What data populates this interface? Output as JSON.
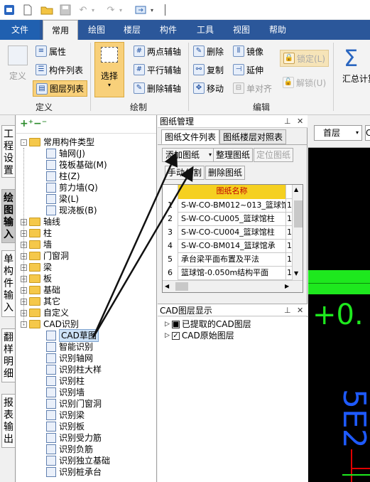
{
  "ribbon_tabs": [
    "文件",
    "常用",
    "绘图",
    "楼层",
    "构件",
    "工具",
    "视图",
    "帮助"
  ],
  "active_tab": "常用",
  "groups": {
    "define": {
      "label": "定义",
      "define_btn": "定义",
      "attr": "属性",
      "component_list": "构件列表",
      "layer_list": "图层列表"
    },
    "draw": {
      "label": "绘制",
      "select": "选择",
      "two_point_aux": "两点辅轴",
      "parallel_aux": "平行辅轴",
      "delete_aux": "删除辅轴"
    },
    "edit": {
      "label": "编辑",
      "delete": "删除",
      "copy": "复制",
      "move": "移动",
      "mirror": "镜像",
      "extend": "延伸",
      "single_align": "单对齐",
      "lock": "锁定(L)",
      "unlock": "解锁(U)"
    },
    "summary": {
      "label": "汇总计算"
    }
  },
  "side_tabs": [
    "工程设置",
    "绘图输入",
    "单构件输入",
    "翻样明细",
    "报表输出"
  ],
  "tree": [
    {
      "label": "常用构件类型",
      "level": 0,
      "kind": "folder",
      "expand": "-"
    },
    {
      "label": "轴网(J)",
      "level": 1,
      "kind": "icon",
      "icon": "axis-grid-icon"
    },
    {
      "label": "筏板基础(M)",
      "level": 1,
      "kind": "icon",
      "icon": "raft-foundation-icon"
    },
    {
      "label": "柱(Z)",
      "level": 1,
      "kind": "icon",
      "icon": "column-icon"
    },
    {
      "label": "剪力墙(Q)",
      "level": 1,
      "kind": "icon",
      "icon": "shear-wall-icon"
    },
    {
      "label": "梁(L)",
      "level": 1,
      "kind": "icon",
      "icon": "beam-icon"
    },
    {
      "label": "现浇板(B)",
      "level": 1,
      "kind": "icon",
      "icon": "slab-icon"
    },
    {
      "label": "轴线",
      "level": 0,
      "kind": "folder",
      "expand": "+"
    },
    {
      "label": "柱",
      "level": 0,
      "kind": "folder",
      "expand": "+"
    },
    {
      "label": "墙",
      "level": 0,
      "kind": "folder",
      "expand": "+"
    },
    {
      "label": "门窗洞",
      "level": 0,
      "kind": "folder",
      "expand": "+"
    },
    {
      "label": "梁",
      "level": 0,
      "kind": "folder",
      "expand": "+"
    },
    {
      "label": "板",
      "level": 0,
      "kind": "folder",
      "expand": "+"
    },
    {
      "label": "基础",
      "level": 0,
      "kind": "folder",
      "expand": "+"
    },
    {
      "label": "其它",
      "level": 0,
      "kind": "folder",
      "expand": "+"
    },
    {
      "label": "自定义",
      "level": 0,
      "kind": "folder",
      "expand": "+"
    },
    {
      "label": "CAD识别",
      "level": 0,
      "kind": "folder",
      "expand": "-"
    },
    {
      "label": "CAD草图",
      "level": 1,
      "kind": "icon",
      "icon": "cad-sketch-icon",
      "selected": true
    },
    {
      "label": "智能识别",
      "level": 1,
      "kind": "icon",
      "icon": "smart-recognize-icon"
    },
    {
      "label": "识别轴网",
      "level": 1,
      "kind": "icon",
      "icon": "recognize-axis-icon"
    },
    {
      "label": "识别柱大样",
      "level": 1,
      "kind": "icon",
      "icon": "recognize-column-detail-icon"
    },
    {
      "label": "识别柱",
      "level": 1,
      "kind": "icon",
      "icon": "recognize-column-icon"
    },
    {
      "label": "识别墙",
      "level": 1,
      "kind": "icon",
      "icon": "recognize-wall-icon"
    },
    {
      "label": "识别门窗洞",
      "level": 1,
      "kind": "icon",
      "icon": "recognize-opening-icon"
    },
    {
      "label": "识别梁",
      "level": 1,
      "kind": "icon",
      "icon": "recognize-beam-icon"
    },
    {
      "label": "识别板",
      "level": 1,
      "kind": "icon",
      "icon": "recognize-slab-icon"
    },
    {
      "label": "识别受力筋",
      "level": 1,
      "kind": "icon",
      "icon": "recognize-main-rebar-icon"
    },
    {
      "label": "识别负筋",
      "level": 1,
      "kind": "icon",
      "icon": "recognize-negative-rebar-icon"
    },
    {
      "label": "识别独立基础",
      "level": 1,
      "kind": "icon",
      "icon": "recognize-isolated-footing-icon"
    },
    {
      "label": "识别桩承台",
      "level": 1,
      "kind": "icon",
      "icon": "recognize-pile-cap-icon"
    }
  ],
  "drawing_manager": {
    "title": "图纸管理",
    "tabs": [
      "图纸文件列表",
      "图纸楼层对照表"
    ],
    "active_tab": "图纸文件列表",
    "buttons": {
      "add": "添加图纸",
      "organize": "整理图纸",
      "locate": "定位图纸",
      "manual_split": "手动分割",
      "delete": "删除图纸"
    },
    "column_header": "图纸名称",
    "rows": [
      {
        "num": "1",
        "name": "S-W-CO-BM012~013_篮球馆",
        "ext": "1"
      },
      {
        "num": "2",
        "name": "S-W-CO-CU005_篮球馆柱",
        "ext": "1"
      },
      {
        "num": "3",
        "name": "S-W-CO-CU004_篮球馆柱",
        "ext": "1"
      },
      {
        "num": "4",
        "name": "S-W-CO-BM014_篮球馆承",
        "ext": "1"
      },
      {
        "num": "5",
        "name": "承台梁平面布置及平法",
        "ext": "1"
      },
      {
        "num": "6",
        "name": "篮球馆-0.050m结构平面",
        "ext": "1"
      }
    ]
  },
  "cad_layers": {
    "title": "CAD图层显示",
    "items": [
      {
        "label": "已提取的CAD图层",
        "checked": "■"
      },
      {
        "label": "CAD原始图层",
        "checked": "✓"
      }
    ]
  },
  "canvas": {
    "floor_select": "首层",
    "floor_extra": "C",
    "text_plus": "+0.",
    "text_vertical": "5E2"
  },
  "colors": {
    "menubar": "#2b579a",
    "canvas_bg": "#000000",
    "canvas_green": "#1ee81e",
    "canvas_blue": "#1e5aff",
    "grid_header": "#f5d020",
    "grid_header_text": "#c00000",
    "selected_btn_bg": "#f8d07a"
  }
}
